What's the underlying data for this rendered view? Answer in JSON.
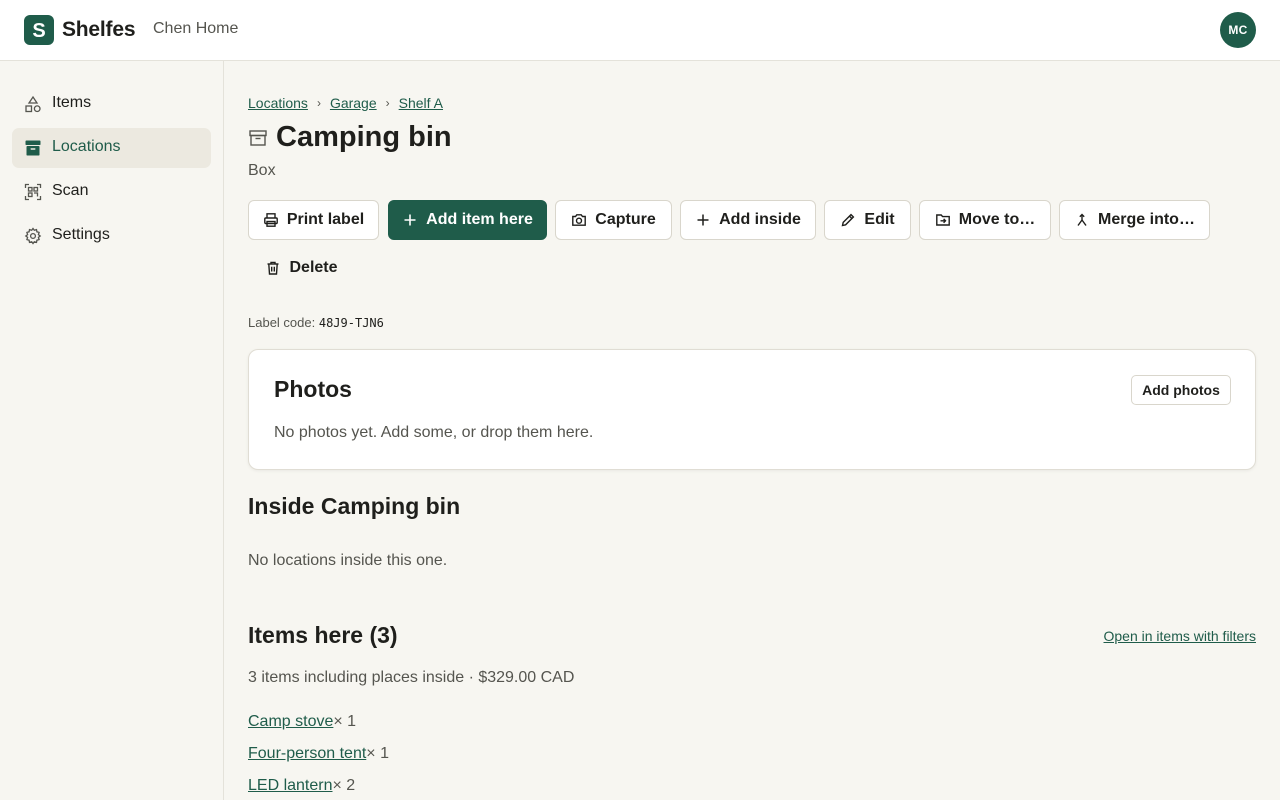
{
  "brand": {
    "logo_letter": "S",
    "name": "Shelfes",
    "workspace": "Chen Home",
    "avatar_initials": "MC",
    "accent": "#1f5c4a"
  },
  "sidebar": {
    "items": [
      {
        "label": "Items",
        "icon": "shapes-icon"
      },
      {
        "label": "Locations",
        "icon": "box-icon",
        "active": true
      },
      {
        "label": "Scan",
        "icon": "qr-scan-icon"
      },
      {
        "label": "Settings",
        "icon": "gear-icon"
      }
    ]
  },
  "breadcrumb": [
    "Locations",
    "Garage",
    "Shelf A"
  ],
  "breadcrumb_separator": "›",
  "location": {
    "title": "Camping bin",
    "type": "Box",
    "title_icon": "archive-icon"
  },
  "actions": {
    "print_label": "Print label",
    "add_item_here": "Add item here",
    "capture": "Capture",
    "add_inside": "Add inside",
    "edit": "Edit",
    "move_to": "Move to…",
    "merge_into": "Merge into…",
    "delete": "Delete"
  },
  "label_code": {
    "label": "Label code:",
    "value": "48J9-TJN6"
  },
  "photos": {
    "title": "Photos",
    "add_button": "Add photos",
    "empty_text": "No photos yet. Add some, or drop them here."
  },
  "inside": {
    "title": "Inside Camping bin",
    "empty_text": "No locations inside this one."
  },
  "items_here": {
    "title": "Items here (3)",
    "filter_link": "Open in items with filters",
    "summary": "3 items including places inside · $329.00 CAD",
    "rows": [
      {
        "name": "Camp stove",
        "qty": "× 1"
      },
      {
        "name": "Four-person tent",
        "qty": "× 1"
      },
      {
        "name": "LED lantern",
        "qty": "× 2"
      }
    ]
  }
}
